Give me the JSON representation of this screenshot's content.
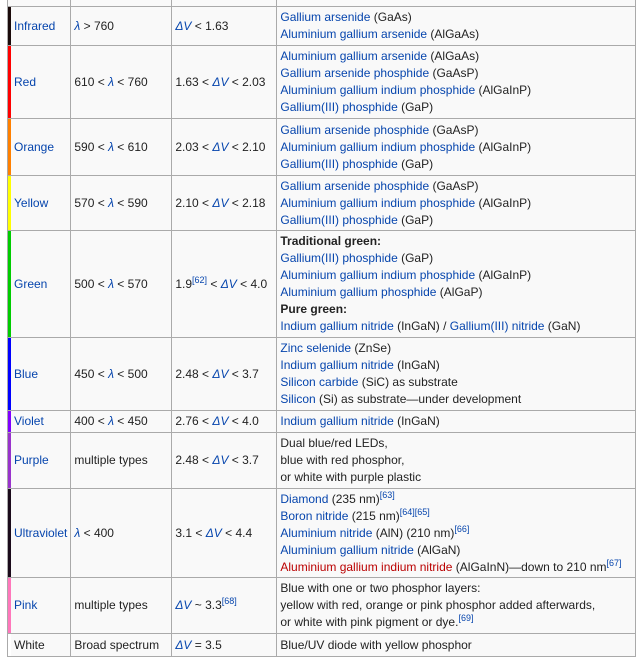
{
  "rows": [
    {
      "name": "Infrared",
      "color": "#1a0a0a",
      "wl": [
        [
          "λ",
          "ilink"
        ],
        [
          " > 760",
          ""
        ]
      ],
      "vt": [
        [
          "ΔV",
          "ilink"
        ],
        [
          " < 1.63",
          ""
        ]
      ],
      "mat": [
        [
          [
            "Gallium arsenide",
            "link"
          ],
          [
            " (GaAs)",
            ""
          ]
        ],
        [
          [
            "Aluminium gallium arsenide",
            "link"
          ],
          [
            " (AlGaAs)",
            ""
          ]
        ]
      ]
    },
    {
      "name": "Red",
      "color": "#ff0000",
      "wl": [
        [
          "610 < ",
          ""
        ],
        [
          "λ",
          "ilink"
        ],
        [
          " < 760",
          ""
        ]
      ],
      "vt": [
        [
          "1.63 < ",
          ""
        ],
        [
          "ΔV",
          "ilink"
        ],
        [
          " < 2.03",
          ""
        ]
      ],
      "mat": [
        [
          [
            "Aluminium gallium arsenide",
            "link"
          ],
          [
            " (AlGaAs)",
            ""
          ]
        ],
        [
          [
            "Gallium arsenide phosphide",
            "link"
          ],
          [
            " (GaAsP)",
            ""
          ]
        ],
        [
          [
            "Aluminium gallium indium phosphide",
            "link"
          ],
          [
            " (AlGaInP)",
            ""
          ]
        ],
        [
          [
            "Gallium(III) phosphide",
            "link"
          ],
          [
            " (GaP)",
            ""
          ]
        ]
      ]
    },
    {
      "name": "Orange",
      "color": "#ff8000",
      "wl": [
        [
          "590 < ",
          ""
        ],
        [
          "λ",
          "ilink"
        ],
        [
          " < 610",
          ""
        ]
      ],
      "vt": [
        [
          "2.03 < ",
          ""
        ],
        [
          "ΔV",
          "ilink"
        ],
        [
          " < 2.10",
          ""
        ]
      ],
      "mat": [
        [
          [
            "Gallium arsenide phosphide",
            "link"
          ],
          [
            " (GaAsP)",
            ""
          ]
        ],
        [
          [
            "Aluminium gallium indium phosphide",
            "link"
          ],
          [
            " (AlGaInP)",
            ""
          ]
        ],
        [
          [
            "Gallium(III) phosphide",
            "link"
          ],
          [
            " (GaP)",
            ""
          ]
        ]
      ]
    },
    {
      "name": "Yellow",
      "color": "#ffff00",
      "wl": [
        [
          "570 < ",
          ""
        ],
        [
          "λ",
          "ilink"
        ],
        [
          " < 590",
          ""
        ]
      ],
      "vt": [
        [
          "2.10 < ",
          ""
        ],
        [
          "ΔV",
          "ilink"
        ],
        [
          " < 2.18",
          ""
        ]
      ],
      "mat": [
        [
          [
            "Gallium arsenide phosphide",
            "link"
          ],
          [
            " (GaAsP)",
            ""
          ]
        ],
        [
          [
            "Aluminium gallium indium phosphide",
            "link"
          ],
          [
            " (AlGaInP)",
            ""
          ]
        ],
        [
          [
            "Gallium(III) phosphide",
            "link"
          ],
          [
            " (GaP)",
            ""
          ]
        ]
      ]
    },
    {
      "name": "Green",
      "color": "#00cc00",
      "wl": [
        [
          "500 < ",
          ""
        ],
        [
          "λ",
          "ilink"
        ],
        [
          " < 570",
          ""
        ]
      ],
      "vt": [
        [
          "1.9",
          ""
        ],
        [
          "[62]",
          "sup"
        ],
        [
          " < ",
          ""
        ],
        [
          "ΔV",
          "ilink"
        ],
        [
          " < 4.0",
          ""
        ]
      ],
      "mat": [
        [
          [
            "Traditional green:",
            "bold"
          ]
        ],
        [
          [
            "Gallium(III) phosphide",
            "link"
          ],
          [
            " (GaP)",
            ""
          ]
        ],
        [
          [
            "Aluminium gallium indium phosphide",
            "link"
          ],
          [
            " (AlGaInP)",
            ""
          ]
        ],
        [
          [
            "Aluminium gallium phosphide",
            "link"
          ],
          [
            " (AlGaP)",
            ""
          ]
        ],
        [
          [
            "Pure green:",
            "bold"
          ]
        ],
        [
          [
            "Indium gallium nitride",
            "link"
          ],
          [
            " (InGaN) / ",
            ""
          ],
          [
            "Gallium(III) nitride",
            "link"
          ],
          [
            " (GaN)",
            ""
          ]
        ]
      ]
    },
    {
      "name": "Blue",
      "color": "#0000ff",
      "wl": [
        [
          "450 < ",
          ""
        ],
        [
          "λ",
          "ilink"
        ],
        [
          " < 500",
          ""
        ]
      ],
      "vt": [
        [
          "2.48 < ",
          ""
        ],
        [
          "ΔV",
          "ilink"
        ],
        [
          " < 3.7",
          ""
        ]
      ],
      "mat": [
        [
          [
            "Zinc selenide",
            "link"
          ],
          [
            " (ZnSe)",
            ""
          ]
        ],
        [
          [
            "Indium gallium nitride",
            "link"
          ],
          [
            " (InGaN)",
            ""
          ]
        ],
        [
          [
            "Silicon carbide",
            "link"
          ],
          [
            " (SiC) as substrate",
            ""
          ]
        ],
        [
          [
            "Silicon",
            "link"
          ],
          [
            " (Si) as substrate—under development",
            ""
          ]
        ]
      ]
    },
    {
      "name": "Violet",
      "color": "#8000ff",
      "wl": [
        [
          "400 < ",
          ""
        ],
        [
          "λ",
          "ilink"
        ],
        [
          " < 450",
          ""
        ]
      ],
      "vt": [
        [
          "2.76 < ",
          ""
        ],
        [
          "ΔV",
          "ilink"
        ],
        [
          " < 4.0",
          ""
        ]
      ],
      "mat": [
        [
          [
            "Indium gallium nitride",
            "link"
          ],
          [
            " (InGaN)",
            ""
          ]
        ]
      ]
    },
    {
      "name": "Purple",
      "color": "#9933cc",
      "wl": [
        [
          "multiple types",
          ""
        ]
      ],
      "vt": [
        [
          "2.48 < ",
          ""
        ],
        [
          "ΔV",
          "ilink"
        ],
        [
          " < 3.7",
          ""
        ]
      ],
      "mat": [
        [
          [
            "Dual blue/red LEDs,",
            ""
          ]
        ],
        [
          [
            "blue with red phosphor,",
            ""
          ]
        ],
        [
          [
            "or white with purple plastic",
            ""
          ]
        ]
      ]
    },
    {
      "name": "Ultraviolet",
      "color": "#1a0a1a",
      "wl": [
        [
          "λ",
          "ilink"
        ],
        [
          " < 400",
          ""
        ]
      ],
      "vt": [
        [
          "3.1 < ",
          ""
        ],
        [
          "ΔV",
          "ilink"
        ],
        [
          " < 4.4",
          ""
        ]
      ],
      "mat": [
        [
          [
            "Diamond",
            "link"
          ],
          [
            " (235 nm)",
            ""
          ],
          [
            "[63]",
            "sup"
          ]
        ],
        [
          [
            "Boron nitride",
            "link"
          ],
          [
            " (215 nm)",
            ""
          ],
          [
            "[64][65]",
            "sup"
          ]
        ],
        [
          [
            "Aluminium nitride",
            "link"
          ],
          [
            " (AlN) (210 nm)",
            ""
          ],
          [
            "[66]",
            "sup"
          ]
        ],
        [
          [
            "Aluminium gallium nitride",
            "link"
          ],
          [
            " (AlGaN)",
            ""
          ]
        ],
        [
          [
            "Aluminium gallium indium nitride",
            "redlink"
          ],
          [
            " (AlGaInN)—down to 210 nm",
            ""
          ],
          [
            "[67]",
            "sup"
          ]
        ]
      ]
    },
    {
      "name": "Pink",
      "color": "#ff77bb",
      "wl": [
        [
          "multiple types",
          ""
        ]
      ],
      "vt": [
        [
          "ΔV",
          "ilink"
        ],
        [
          " ~ 3.3",
          ""
        ],
        [
          "[68]",
          "sup"
        ]
      ],
      "mat": [
        [
          [
            "Blue with one or two phosphor layers:",
            ""
          ]
        ],
        [
          [
            "yellow with red, orange or pink phosphor added afterwards,",
            ""
          ]
        ],
        [
          [
            "or white with pink pigment or dye.",
            ""
          ],
          [
            "[69]",
            "sup"
          ]
        ]
      ]
    },
    {
      "name": "White",
      "color": "#ffffff",
      "plain": true,
      "wl": [
        [
          "Broad spectrum",
          ""
        ]
      ],
      "vt": [
        [
          "ΔV",
          "ilink"
        ],
        [
          " = 3.5",
          ""
        ]
      ],
      "mat": [
        [
          [
            "Blue/UV diode with yellow phosphor",
            ""
          ]
        ]
      ]
    }
  ]
}
